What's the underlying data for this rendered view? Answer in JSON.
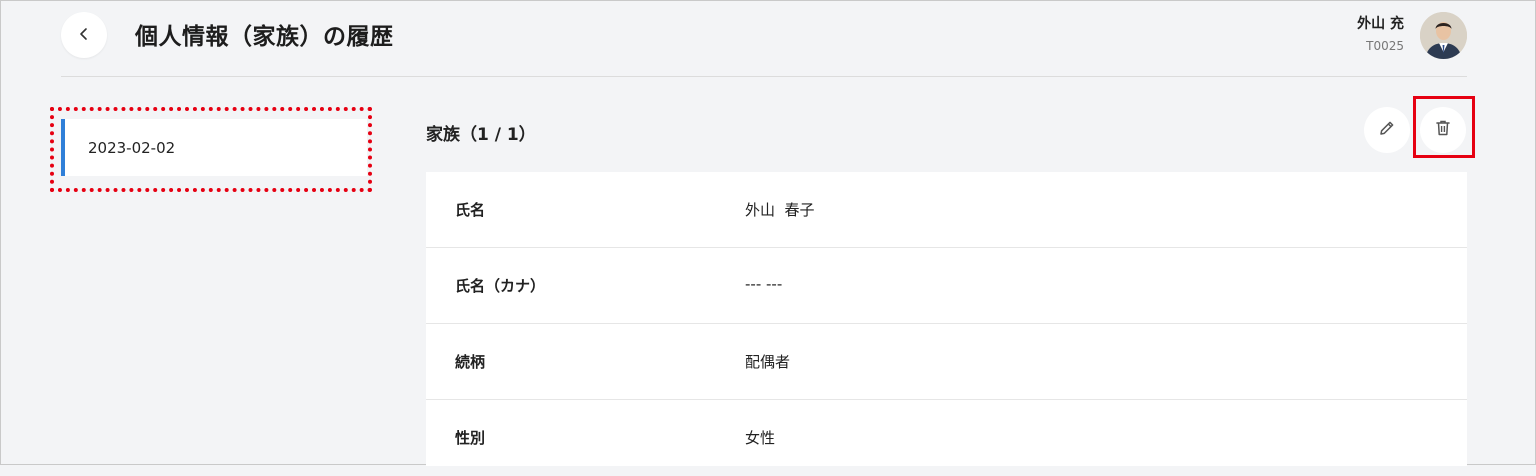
{
  "header": {
    "title": "個人情報（家族）の履歴",
    "user_name": "外山 充",
    "user_id": "T0025"
  },
  "history": {
    "items": [
      {
        "date": "2023-02-02"
      }
    ]
  },
  "section": {
    "title": "家族（1 / 1）"
  },
  "details": {
    "rows": [
      {
        "label": "氏名",
        "value": "外山  春子"
      },
      {
        "label": "氏名（カナ）",
        "value": "--- ---"
      },
      {
        "label": "続柄",
        "value": "配偶者"
      },
      {
        "label": "性別",
        "value": "女性"
      }
    ]
  },
  "icons": {
    "back": "chevron-left-icon",
    "edit": "pencil-icon",
    "delete": "trash-icon",
    "avatar": "user-photo"
  },
  "colors": {
    "accent": "#2f7fd8",
    "highlight": "#e60012",
    "background": "#f3f4f6"
  }
}
